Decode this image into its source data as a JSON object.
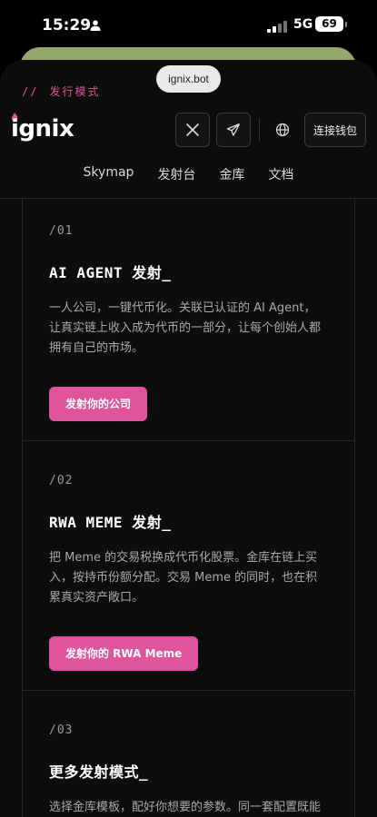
{
  "status_bar": {
    "time": "15:29",
    "network": "5G",
    "battery": "69"
  },
  "browser": {
    "url": "ignix.bot"
  },
  "header": {
    "mode_slashes": "//",
    "mode_label": "发行模式",
    "logo_text": "ignix",
    "x_icon": "x-logo-icon",
    "telegram_icon": "telegram-icon",
    "globe_icon": "globe-icon",
    "wallet_label": "连接钱包"
  },
  "nav": {
    "items": [
      "Skymap",
      "发射台",
      "金库",
      "文档"
    ]
  },
  "cards": [
    {
      "num": "/01",
      "title": "AI AGENT 发射_",
      "desc": "一人公司，一键代币化。关联已认证的 AI Agent，让真实链上收入成为代币的一部分，让每个创始人都拥有自己的市场。",
      "button": "发射你的公司"
    },
    {
      "num": "/02",
      "title": "RWA MEME 发射_",
      "desc": "把 Meme 的交易税换成代币化股票。金库在链上买入，按持币份额分配。交易 Meme 的同时，也在积累真实资产敞口。",
      "button": "发射你的 RWA Meme"
    },
    {
      "num": "/03",
      "title": "更多发射模式_",
      "desc": "选择金库模板，配好你想要的参数。同一套配置既能发社区代币，也能发其他资产。"
    }
  ],
  "colors": {
    "accent": "#e0549b",
    "background": "#0d0d0d"
  }
}
